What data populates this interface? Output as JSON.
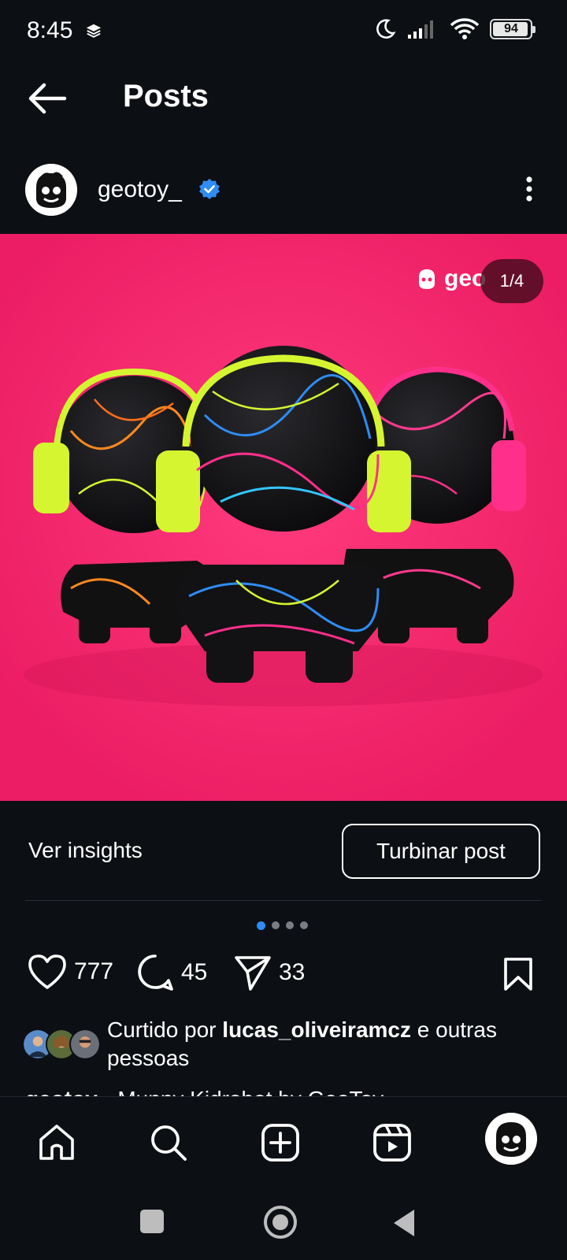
{
  "status_bar": {
    "time": "8:45",
    "battery": "94"
  },
  "header": {
    "title": "Posts"
  },
  "post": {
    "username": "geotoy_",
    "brand_logo_text": "geo",
    "page_counter": "1/4",
    "insights_label": "Ver insights",
    "boost_label": "Turbinar post",
    "carousel_pages": 4,
    "carousel_active": 1,
    "likes": "777",
    "comments": "45",
    "shares": "33",
    "liked_by_prefix": "Curtido por",
    "liked_by_user": "lucas_oliveiramcz",
    "liked_by_suffix": "e outras pessoas",
    "caption_user": "geotoy_",
    "caption_text": "Munny Kidrobot by GeoToy"
  },
  "colors": {
    "background": "#0c0f14",
    "post_bg": "#f4236a",
    "verified": "#2f8cf3",
    "active_dot": "#2f8cf3",
    "neon_yellow": "#d6f531",
    "neon_pink": "#ff2f8a"
  },
  "icons": {
    "back": "arrow-left-icon",
    "verified": "verified-badge-icon",
    "more": "more-vertical-icon",
    "like": "heart-icon",
    "comment": "comment-icon",
    "share": "send-icon",
    "save": "bookmark-icon",
    "nav": [
      "home-icon",
      "search-icon",
      "create-icon",
      "reels-icon",
      "profile-avatar"
    ]
  }
}
